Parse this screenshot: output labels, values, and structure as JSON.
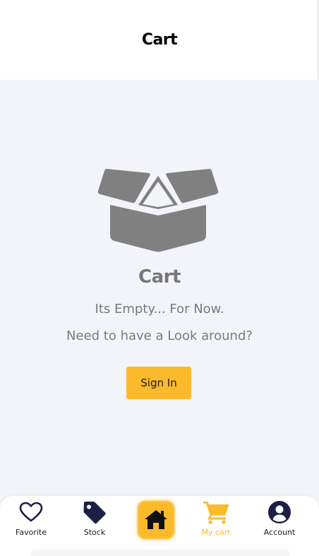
{
  "header": {
    "title": "Cart"
  },
  "empty_state": {
    "icon": "open-box-icon",
    "title": "Cart",
    "line1": "Its Empty... For Now.",
    "line2": "Need to have a Look around?",
    "sign_in_label": "Sign In"
  },
  "bottom_nav": {
    "items": [
      {
        "label": "Favorite",
        "icon": "heart-icon",
        "active": false
      },
      {
        "label": "Stock",
        "icon": "tag-icon",
        "active": false
      },
      {
        "label": "",
        "icon": "home-icon",
        "active": false
      },
      {
        "label": "My cart",
        "icon": "cart-icon",
        "active": true
      },
      {
        "label": "Account",
        "icon": "account-icon",
        "active": false
      }
    ]
  },
  "colors": {
    "accent": "#fbba2c",
    "background": "#f2f4fa",
    "muted_text": "#7a7a7a",
    "icon_gray": "#808080",
    "nav_icon": "#1c2143"
  }
}
